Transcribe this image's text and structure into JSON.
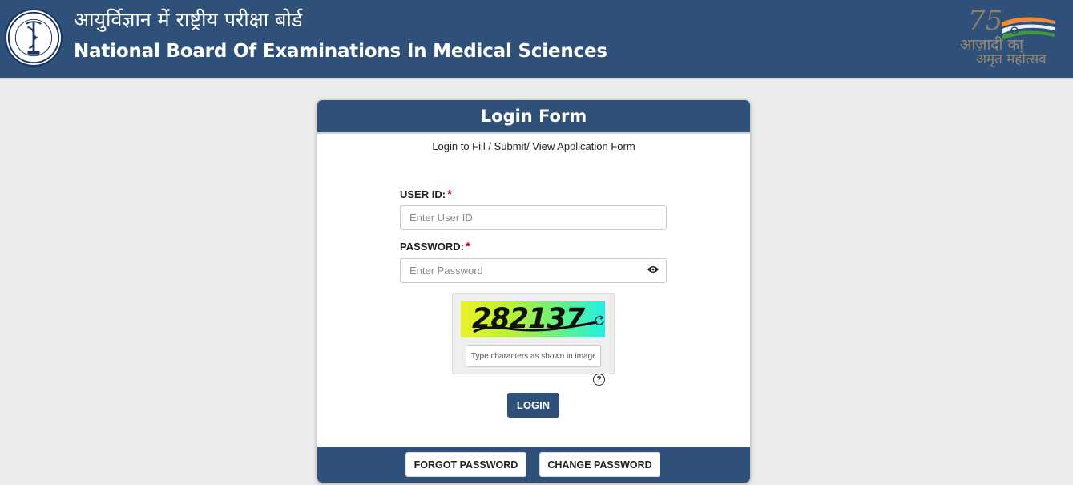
{
  "header": {
    "hindi_title": "आयुर्विज्ञान में राष्ट्रीय परीक्षा बोर्ड",
    "english_title": "National Board Of Examinations In Medical Sciences",
    "logo_icon": "nbems-emblem-icon",
    "azadi": {
      "number": "75",
      "line1": "आज़ादी का",
      "line2": "अमृत महोत्सव"
    }
  },
  "form": {
    "title": "Login Form",
    "subtitle": "Login to Fill / Submit/ View Application Form",
    "user_id_label": "USER ID:",
    "user_id_placeholder": "Enter User ID",
    "password_label": "PASSWORD:",
    "password_placeholder": "Enter Password",
    "required_mark": "*",
    "captcha_text": "282137",
    "captcha_placeholder": "Type characters as shown in image",
    "help_symbol": "?",
    "login_label": "LOGIN",
    "forgot_label": "FORGOT PASSWORD",
    "change_label": "CHANGE PASSWORD"
  },
  "colors": {
    "brand_blue": "#2f5078",
    "required_red": "#d0021b",
    "page_bg": "#ececec"
  }
}
